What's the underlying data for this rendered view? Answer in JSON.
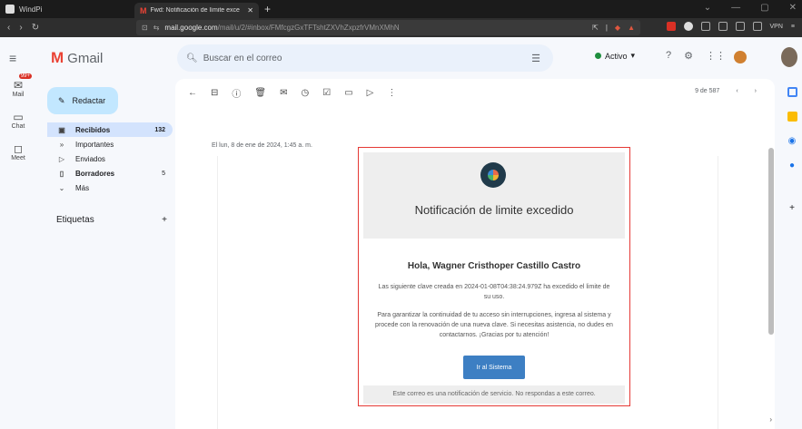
{
  "window": {
    "app_name": "WindPi",
    "tab_title": "Fwd: Notificación de límite exce",
    "controls": [
      "⌄",
      "—",
      "▢",
      "✕"
    ]
  },
  "address": {
    "host": "mail.google.com",
    "path": "/mail/u/2/#inbox/FMfcgzGxTFTshtZXVhZxpzfrVMnXMhN",
    "vpn_label": "VPN"
  },
  "gmail": {
    "logo_text": "Gmail",
    "search_placeholder": "Buscar en el correo",
    "status_label": "Activo",
    "compose_label": "Redactar",
    "rail": [
      {
        "label": "Mail",
        "badge": "99+"
      },
      {
        "label": "Chat"
      },
      {
        "label": "Meet"
      }
    ],
    "nav": [
      {
        "label": "Recibidos",
        "count": "132"
      },
      {
        "label": "Importantes",
        "count": ""
      },
      {
        "label": "Enviados",
        "count": ""
      },
      {
        "label": "Borradores",
        "count": "5"
      },
      {
        "label": "Más",
        "count": ""
      }
    ],
    "labels_heading": "Etiquetas",
    "pager": "9 de 587"
  },
  "email": {
    "datetime": "El lun, 8 de ene de 2024, 1:45 a. m.",
    "title": "Notificación de limite excedido",
    "greeting": "Hola, Wagner Cristhoper Castillo Castro",
    "paragraph1": "Las siguiente clave creada en 2024-01-08T04:38:24.979Z ha excedido el limite de su uso.",
    "paragraph2": "Para garantizar la continuidad de tu acceso sin interrupciones, ingresa al sistema y procede con la renovación de una nueva clave. Si necesitas asistencia, no dudes en contactarnos. ¡Gracias por tu atención!",
    "button_label": "Ir al Sistema",
    "footer": "Este correo es una notificación de servicio. No respondas a este correo."
  },
  "colors": {
    "highlight_border": "#e53935",
    "button": "#3d7fc3",
    "compose_bg": "#c2e7ff",
    "active_nav_bg": "#d3e3fd"
  }
}
